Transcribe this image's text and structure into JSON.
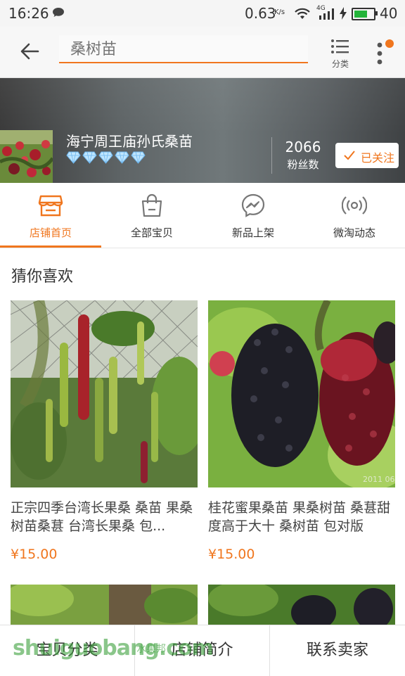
{
  "status": {
    "time": "16:26",
    "speed": "0.63",
    "speed_unit": "K/s",
    "net": "4G",
    "battery": "40"
  },
  "header": {
    "search_placeholder": "桑树苗",
    "category_label": "分类"
  },
  "shop": {
    "name": "海宁周王庙孙氏桑苗",
    "fans_count": "2066",
    "fans_label": "粉丝数",
    "follow_label": "已关注",
    "diamond_count": 5
  },
  "tabs": [
    {
      "label": "店铺首页",
      "icon": "store-icon",
      "active": true
    },
    {
      "label": "全部宝贝",
      "icon": "shopping-bag-icon",
      "active": false
    },
    {
      "label": "新品上架",
      "icon": "messenger-icon",
      "active": false
    },
    {
      "label": "微淘动态",
      "icon": "broadcast-icon",
      "active": false
    }
  ],
  "section": {
    "title": "猜你喜欢"
  },
  "products": [
    {
      "title": "正宗四季台湾长果桑 桑苗 果桑树苗桑葚 台湾长果桑 包...",
      "price": "¥15.00"
    },
    {
      "title": "桂花蜜果桑苗 果桑树苗 桑葚甜度高于大十 桑树苗 包对版",
      "price": "¥15.00"
    }
  ],
  "photo_stamp": "2011 06",
  "bottom": {
    "categories": "宝贝分类",
    "intro": "店铺简介",
    "contact": "联系卖家"
  },
  "watermark": {
    "text": "shuiguobang.com",
    "small": "水果邦"
  },
  "colors": {
    "accent": "#f0761e"
  }
}
